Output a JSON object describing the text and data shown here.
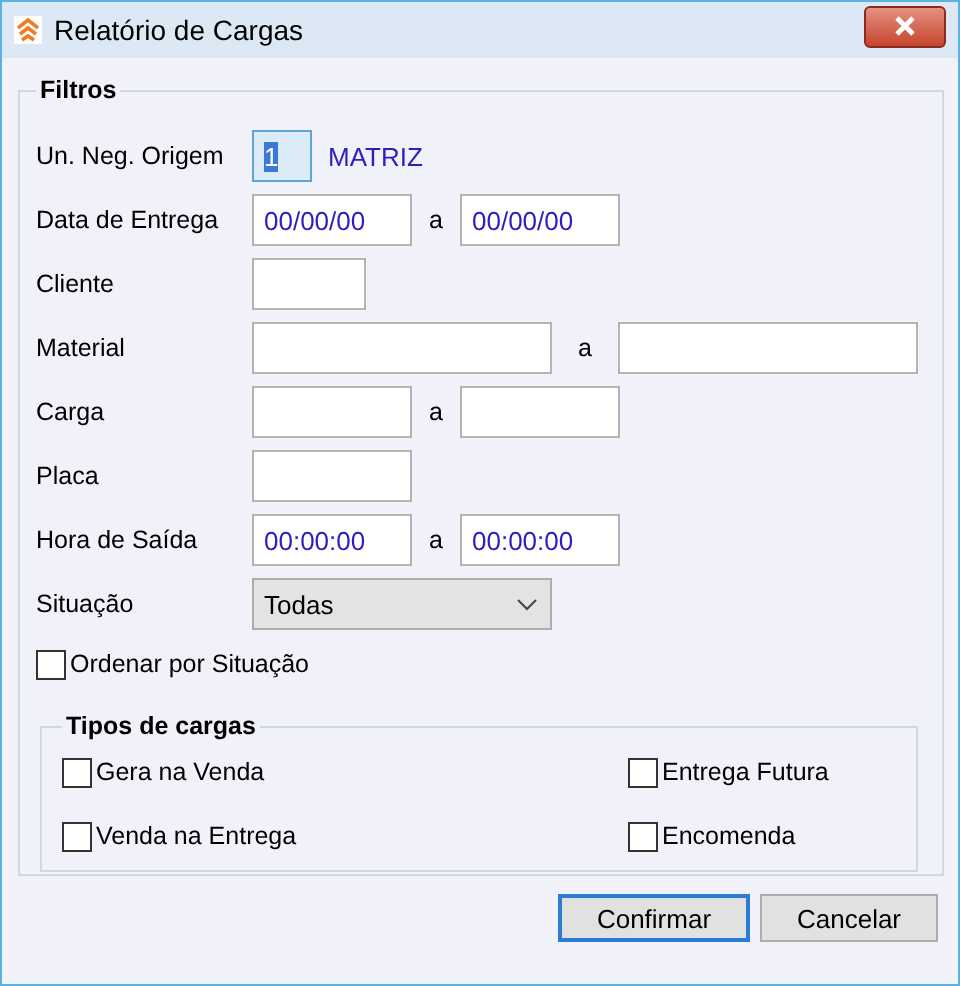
{
  "window": {
    "title": "Relatório de Cargas"
  },
  "filters": {
    "title": "Filtros",
    "rows": [
      {
        "label": "Un. Neg. Origem",
        "fields": [
          {
            "kind": "code",
            "value": "1",
            "selected": true
          }
        ],
        "description": "MATRIZ"
      },
      {
        "label": "Data de Entrega",
        "fields": [
          {
            "kind": "date",
            "value": "00/00/00",
            "selected": false
          },
          {
            "kind": "date",
            "value": "00/00/00",
            "selected": false
          }
        ],
        "range_word": "a"
      },
      {
        "label": "Cliente",
        "fields": [
          {
            "kind": "client",
            "selected": false
          }
        ]
      },
      {
        "label": "Material",
        "fields": [
          {
            "kind": "material",
            "selected": false
          },
          {
            "kind": "material",
            "selected": false
          }
        ],
        "range_word": "a"
      },
      {
        "label": "Carga",
        "fields": [
          {
            "kind": "load",
            "selected": false
          },
          {
            "kind": "load",
            "selected": false
          }
        ],
        "range_word": "a"
      },
      {
        "label": "Placa",
        "fields": [
          {
            "kind": "plate",
            "selected": false
          }
        ]
      },
      {
        "label": "Hora de Saída",
        "fields": [
          {
            "kind": "time",
            "value": "00:00:00",
            "selected": false
          },
          {
            "kind": "time",
            "value": "00:00:00",
            "selected": false
          }
        ],
        "range_word": "a"
      },
      {
        "label": "Situação",
        "fields": [
          {
            "kind": "select",
            "value": "Todas",
            "selected": false
          }
        ]
      }
    ],
    "order_checkbox": {
      "label": "Ordenar por Situação",
      "checked": false
    },
    "types": {
      "title": "Tipos de cargas",
      "options": [
        {
          "label": "Gera na Venda",
          "checked": false
        },
        {
          "label": "Entrega Futura",
          "checked": false
        },
        {
          "label": "Venda na Entrega",
          "checked": false
        },
        {
          "label": "Encomenda",
          "checked": false
        }
      ]
    }
  },
  "buttons": [
    {
      "label": "Confirmar",
      "default": true
    },
    {
      "label": "Cancelar",
      "default": false
    }
  ]
}
